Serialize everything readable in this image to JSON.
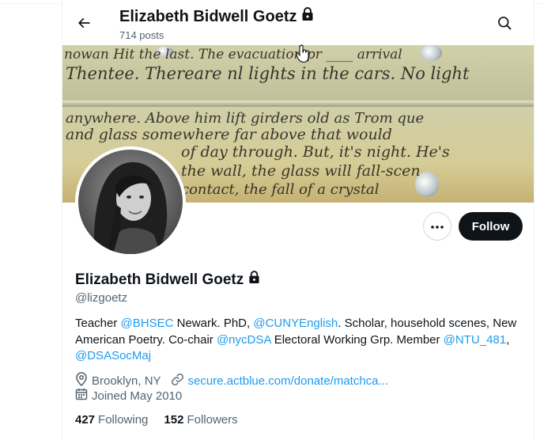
{
  "header": {
    "title": "Elizabeth Bidwell Goetz",
    "post_count": "714 posts"
  },
  "profile": {
    "display_name": "Elizabeth Bidwell Goetz",
    "handle": "@lizgoetz",
    "bio": [
      {
        "text": "Teacher ",
        "mention": false
      },
      {
        "text": "@BHSEC",
        "mention": true
      },
      {
        "text": " Newark. PhD, ",
        "mention": false
      },
      {
        "text": "@CUNYEnglish",
        "mention": true
      },
      {
        "text": ". Scholar, household scenes, New American Poetry. Co-chair ",
        "mention": false
      },
      {
        "text": "@nycDSA",
        "mention": true
      },
      {
        "text": " Electoral Working Grp. Member ",
        "mention": false
      },
      {
        "text": "@NTU_481",
        "mention": true
      },
      {
        "text": ", ",
        "mention": false
      },
      {
        "text": "@DSASocMaj",
        "mention": true
      }
    ],
    "location": "Brooklyn, NY",
    "website": "secure.actblue.com/donate/matchca...",
    "joined": "Joined May 2010",
    "following_count": "427",
    "following_label": "Following",
    "followers_count": "152",
    "followers_label": "Followers"
  },
  "actions": {
    "follow_label": "Follow"
  },
  "icons": {
    "back": "arrow-left-icon",
    "search": "search-icon",
    "lock": "lock-icon",
    "more": "more-icon",
    "location": "location-pin-icon",
    "link": "link-icon",
    "calendar": "calendar-icon"
  },
  "colors": {
    "accent": "#1d9bf0",
    "text": "#0f1419",
    "secondary_text": "#536471",
    "follow_button": "#0f1419"
  }
}
